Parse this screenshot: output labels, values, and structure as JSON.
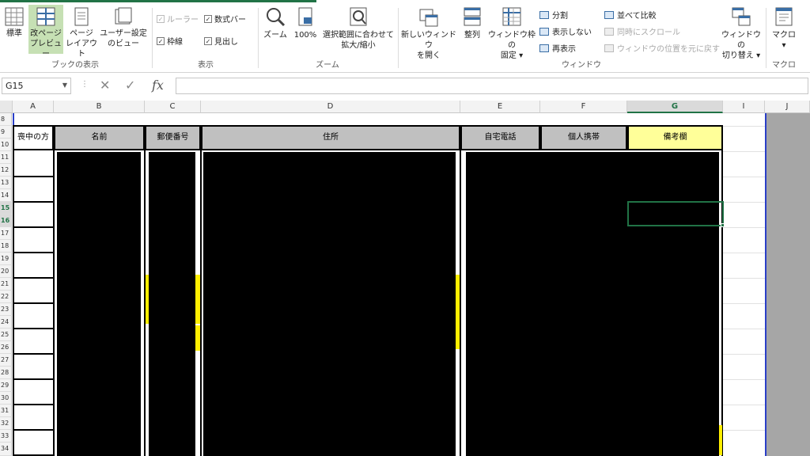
{
  "ribbon": {
    "workbook_views": {
      "normal": "標準",
      "page_break_preview_l1": "改ページ",
      "page_break_preview_l2": "プレビュー",
      "page_layout_l1": "ページ",
      "page_layout_l2": "レイアウト",
      "custom_views_l1": "ユーザー設定",
      "custom_views_l2": "のビュー",
      "group_label": "ブックの表示"
    },
    "show": {
      "ruler": "ルーラー",
      "formula_bar": "数式バー",
      "gridlines": "枠線",
      "headings": "見出し",
      "group_label": "表示"
    },
    "zoom": {
      "zoom": "ズーム",
      "hundred": "100%",
      "zoom_selection_l1": "選択範囲に合わせて",
      "zoom_selection_l2": "拡大/縮小",
      "group_label": "ズーム"
    },
    "window": {
      "new_window_l1": "新しいウィンドウ",
      "new_window_l2": "を開く",
      "arrange_all": "整列",
      "freeze_panes_l1": "ウィンドウ枠の",
      "freeze_panes_l2": "固定",
      "split": "分割",
      "hide": "表示しない",
      "unhide": "再表示",
      "view_side_by_side": "並べて比較",
      "sync_scroll": "同時にスクロール",
      "reset_position": "ウィンドウの位置を元に戻す",
      "switch_windows_l1": "ウィンドウの",
      "switch_windows_l2": "切り替え",
      "group_label": "ウィンドウ"
    },
    "macros": {
      "macros": "マクロ",
      "group_label": "マクロ"
    }
  },
  "formula_bar": {
    "name_box": "G15",
    "fx": "fx",
    "formula": ""
  },
  "columns": [
    "A",
    "B",
    "C",
    "D",
    "E",
    "F",
    "G",
    "I",
    "J"
  ],
  "rows": [
    "8",
    "9",
    "10",
    "11",
    "12",
    "13",
    "14",
    "15",
    "16",
    "17",
    "18",
    "19",
    "20",
    "21",
    "22",
    "23",
    "24",
    "25",
    "26",
    "27",
    "28",
    "29",
    "30",
    "31",
    "32",
    "33",
    "34"
  ],
  "table_headers": {
    "a": "喪中の方",
    "b": "名前",
    "c": "郵便番号",
    "d": "住所",
    "e": "自宅電話",
    "f": "個人携帯",
    "g": "備考欄"
  },
  "colors": {
    "accent": "#217346",
    "header_gray": "#c0c0c0",
    "header_yellow": "#ffff99",
    "highlight_yellow": "#ffee00",
    "redaction": "#000000"
  }
}
